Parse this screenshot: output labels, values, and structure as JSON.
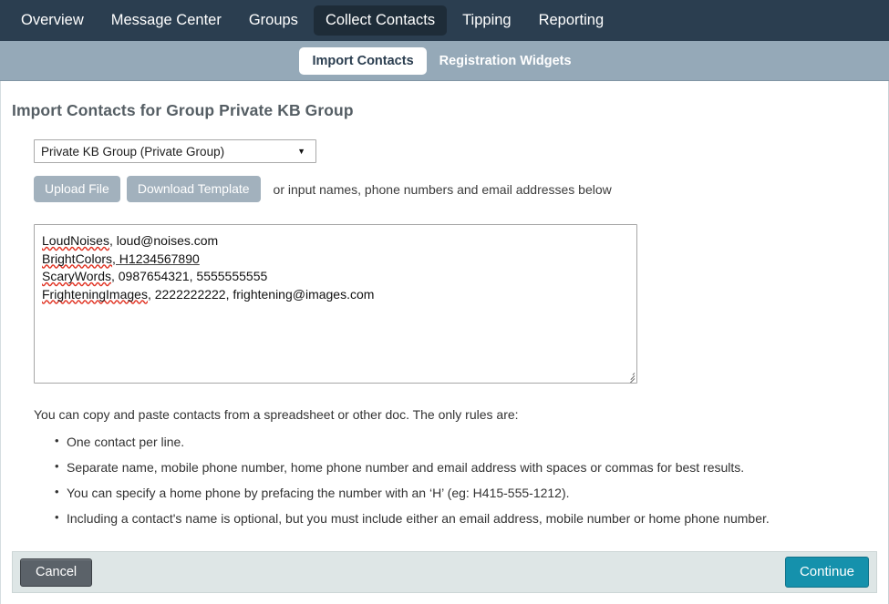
{
  "primary_nav": {
    "items": [
      {
        "label": "Overview",
        "active": false
      },
      {
        "label": "Message Center",
        "active": false
      },
      {
        "label": "Groups",
        "active": false
      },
      {
        "label": "Collect Contacts",
        "active": true
      },
      {
        "label": "Tipping",
        "active": false
      },
      {
        "label": "Reporting",
        "active": false
      }
    ]
  },
  "secondary_nav": {
    "items": [
      {
        "label": "Import Contacts",
        "active": true
      },
      {
        "label": "Registration Widgets",
        "active": false
      }
    ]
  },
  "page": {
    "title": "Import Contacts for Group Private KB Group"
  },
  "form": {
    "group_select": {
      "value": "Private KB Group (Private Group)",
      "caret": "▼",
      "options": [
        "Private KB Group (Private Group)"
      ]
    },
    "upload_button": "Upload File",
    "template_button": "Download Template",
    "hint": "or input names, phone numbers and email addresses below",
    "contacts_textarea": {
      "placeholder": "",
      "lines": [
        {
          "name": "LoudNoises",
          "rest": ", loud@noises.com"
        },
        {
          "name": "BrightColors",
          "rest": ", H1234567890"
        },
        {
          "name": "ScaryWords",
          "rest": ", 0987654321, 5555555555"
        },
        {
          "name": "FrighteningImages",
          "rest": ", 2222222222, frightening@images.com"
        }
      ],
      "value": "LoudNoises, loud@noises.com\nBrightColors, H1234567890\nScaryWords, 0987654321, 5555555555\nFrighteningImages, 2222222222, frightening@images.com"
    }
  },
  "rules": {
    "intro": "You can copy and paste contacts from a spreadsheet or other doc. The only rules are:",
    "items": [
      "One contact per line.",
      "Separate name, mobile phone number, home phone number and email address with spaces or commas for best results.",
      "You can specify a home phone by prefacing the number with an ‘H’ (eg: H415-555-1212).",
      "Including a contact's name is optional, but you must include either an email address, mobile number or home phone number."
    ]
  },
  "footer": {
    "cancel_label": "Cancel",
    "continue_label": "Continue"
  },
  "colors": {
    "primary_nav_bg": "#2b3e50",
    "primary_nav_active_bg": "#1e2c38",
    "secondary_nav_bg": "#95a9b8",
    "grey_button": "#a2b1bd",
    "cancel_button": "#5b6269",
    "continue_button": "#1591ac",
    "footer_bar": "#dee6e6",
    "title_text": "#555e64",
    "spellcheck_underline": "#e03020"
  }
}
